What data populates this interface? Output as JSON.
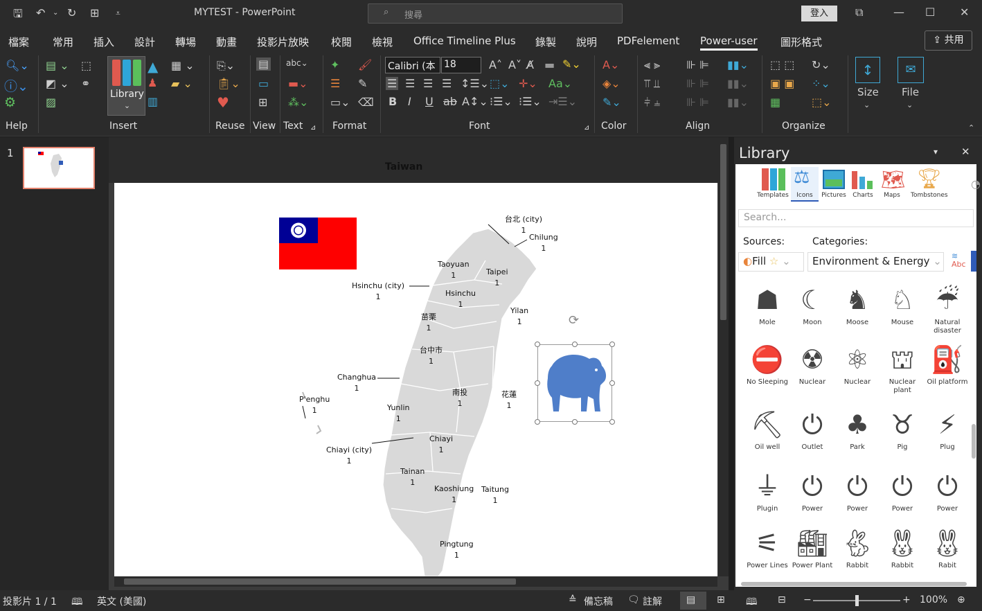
{
  "titlebar": {
    "doc_title": "MYTEST - PowerPoint",
    "search_placeholder": "搜尋",
    "signin": "登入"
  },
  "menu": {
    "items": [
      "檔案",
      "常用",
      "插入",
      "設計",
      "轉場",
      "動畫",
      "投影片放映",
      "校閱",
      "檢視",
      "Office Timeline Plus",
      "錄製",
      "說明",
      "PDFelement",
      "Power-user",
      "圖形格式"
    ],
    "active": "Power-user",
    "share": "共用"
  },
  "ribbon": {
    "groups": [
      "Help",
      "Insert",
      "Reuse",
      "View",
      "Text",
      "Format",
      "Font",
      "Color",
      "Align",
      "Organize"
    ],
    "library_label": "Library",
    "font_name": "Calibri (本",
    "font_size": "18",
    "size_label": "Size",
    "file_label": "File"
  },
  "slide_panel": {
    "number": "1"
  },
  "slide": {
    "title": "Taiwan",
    "labels": [
      {
        "name": "台北 (city)",
        "value": "1"
      },
      {
        "name": "Chilung",
        "value": "1"
      },
      {
        "name": "Taoyuan",
        "value": "1"
      },
      {
        "name": "Taipei",
        "value": "1"
      },
      {
        "name": "Hsinchu (city)",
        "value": "1"
      },
      {
        "name": "Hsinchu",
        "value": "1"
      },
      {
        "name": "苗栗",
        "value": "1"
      },
      {
        "name": "Yilan",
        "value": "1"
      },
      {
        "name": "台中市",
        "value": "1"
      },
      {
        "name": "Changhua",
        "value": "1"
      },
      {
        "name": "南投",
        "value": "1"
      },
      {
        "name": "花蓮",
        "value": "1"
      },
      {
        "name": "P'enghu",
        "value": "1"
      },
      {
        "name": "Yunlin",
        "value": "1"
      },
      {
        "name": "Chiayi",
        "value": "1"
      },
      {
        "name": "Chiayi (city)",
        "value": "1"
      },
      {
        "name": "Tainan",
        "value": "1"
      },
      {
        "name": "Kaoshiung",
        "value": "1"
      },
      {
        "name": "Taitung",
        "value": "1"
      },
      {
        "name": "Pingtung",
        "value": "1"
      }
    ]
  },
  "library": {
    "title": "Library",
    "tabs": [
      "Templates",
      "Icons",
      "Pictures",
      "Charts",
      "Maps",
      "Tombstones"
    ],
    "active_tab": "Icons",
    "search_placeholder": "Search...",
    "sources_label": "Sources:",
    "categories_label": "Categories:",
    "source_value": "Fill",
    "category_value": "Environment & Energy",
    "icons": [
      "Mole",
      "Moon",
      "Moose",
      "Mouse",
      "Natural disaster",
      "No Sleeping",
      "Nuclear",
      "Nuclear",
      "Nuclear plant",
      "Oil platform",
      "Oil well",
      "Outlet",
      "Park",
      "Pig",
      "Plug",
      "Plugin",
      "Power",
      "Power",
      "Power",
      "Power",
      "Power Lines",
      "Power Plant",
      "Rabbit",
      "Rabbit",
      "Rabit"
    ]
  },
  "statusbar": {
    "slide_info": "投影片 1 / 1",
    "language": "英文 (美國)",
    "notes": "備忘稿",
    "comments": "註解",
    "zoom": "100%"
  },
  "colors": {
    "accent": "#2f5bb7",
    "flag_red": "#fe0000",
    "flag_blue": "#000095",
    "map_fill": "#d9d9d9"
  }
}
